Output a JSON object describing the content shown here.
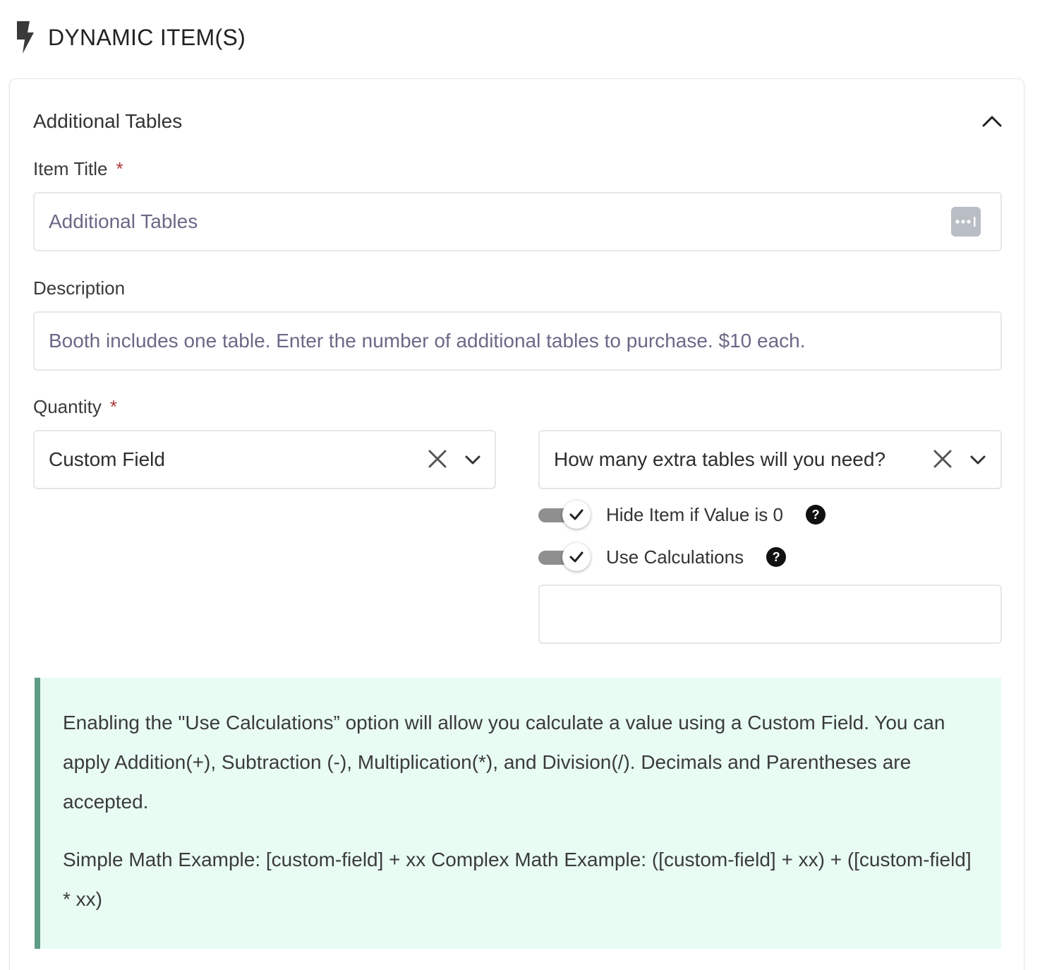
{
  "section": {
    "title": "DYNAMIC ITEM(S)",
    "icon": "bolt-icon"
  },
  "card": {
    "title": "Additional Tables",
    "collapse_icon": "chevron-up-icon"
  },
  "item_title": {
    "label": "Item Title",
    "required_mark": "*",
    "value": "Additional Tables",
    "action_icon": "more-options-icon"
  },
  "description": {
    "label": "Description",
    "value": "Booth includes one table. Enter the number of additional tables to purchase. $10 each."
  },
  "quantity": {
    "label": "Quantity",
    "required_mark": "*",
    "source_select": {
      "value": "Custom Field"
    },
    "field_select": {
      "value": "How many extra tables will you need?"
    },
    "hide_if_zero": {
      "label": "Hide Item if Value is 0",
      "checked": true,
      "help": "?"
    },
    "use_calculations": {
      "label": "Use Calculations",
      "checked": true,
      "help": "?"
    },
    "calculation_input": {
      "value": ""
    }
  },
  "notice": {
    "paragraph1": "Enabling the \"Use Calculations” option will allow you calculate a value using a Custom Field. You can apply Addition(+), Subtraction (-), Multiplication(*), and Division(/). Decimals and Parentheses are accepted.",
    "paragraph2": "Simple Math Example: [custom-field] + xx Complex Math Example: ([custom-field] + xx) + ([custom-field] * xx)"
  },
  "colors": {
    "notice_bg": "#e8fcf3",
    "notice_border": "#5f9c86",
    "required": "#b03a3a",
    "input_text": "#6e6787"
  }
}
